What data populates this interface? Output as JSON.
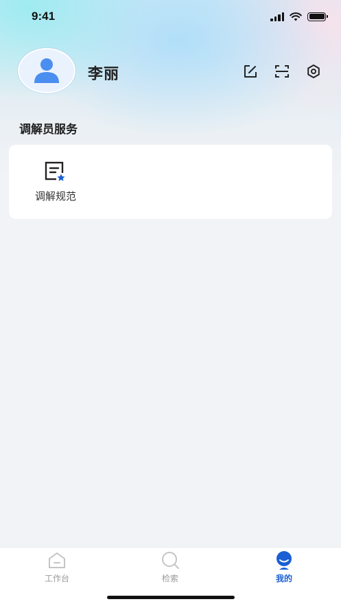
{
  "status_bar": {
    "time": "9:41"
  },
  "profile": {
    "name": "李丽"
  },
  "top_actions": [
    {
      "icon": "edit-icon"
    },
    {
      "icon": "scan-icon"
    },
    {
      "icon": "gear-icon"
    }
  ],
  "services": {
    "title": "调解员服务",
    "items": [
      {
        "label": "调解规范",
        "icon": "document-star-icon"
      }
    ]
  },
  "tabs": [
    {
      "label": "工作台",
      "icon": "workbench-icon",
      "active": false
    },
    {
      "label": "检索",
      "icon": "search-icon",
      "active": false
    },
    {
      "label": "我的",
      "icon": "profile-icon",
      "active": true
    }
  ],
  "colors": {
    "accent": "#1a5fd3",
    "avatar": "#4a8ef0",
    "tab_inactive": "#999999"
  }
}
